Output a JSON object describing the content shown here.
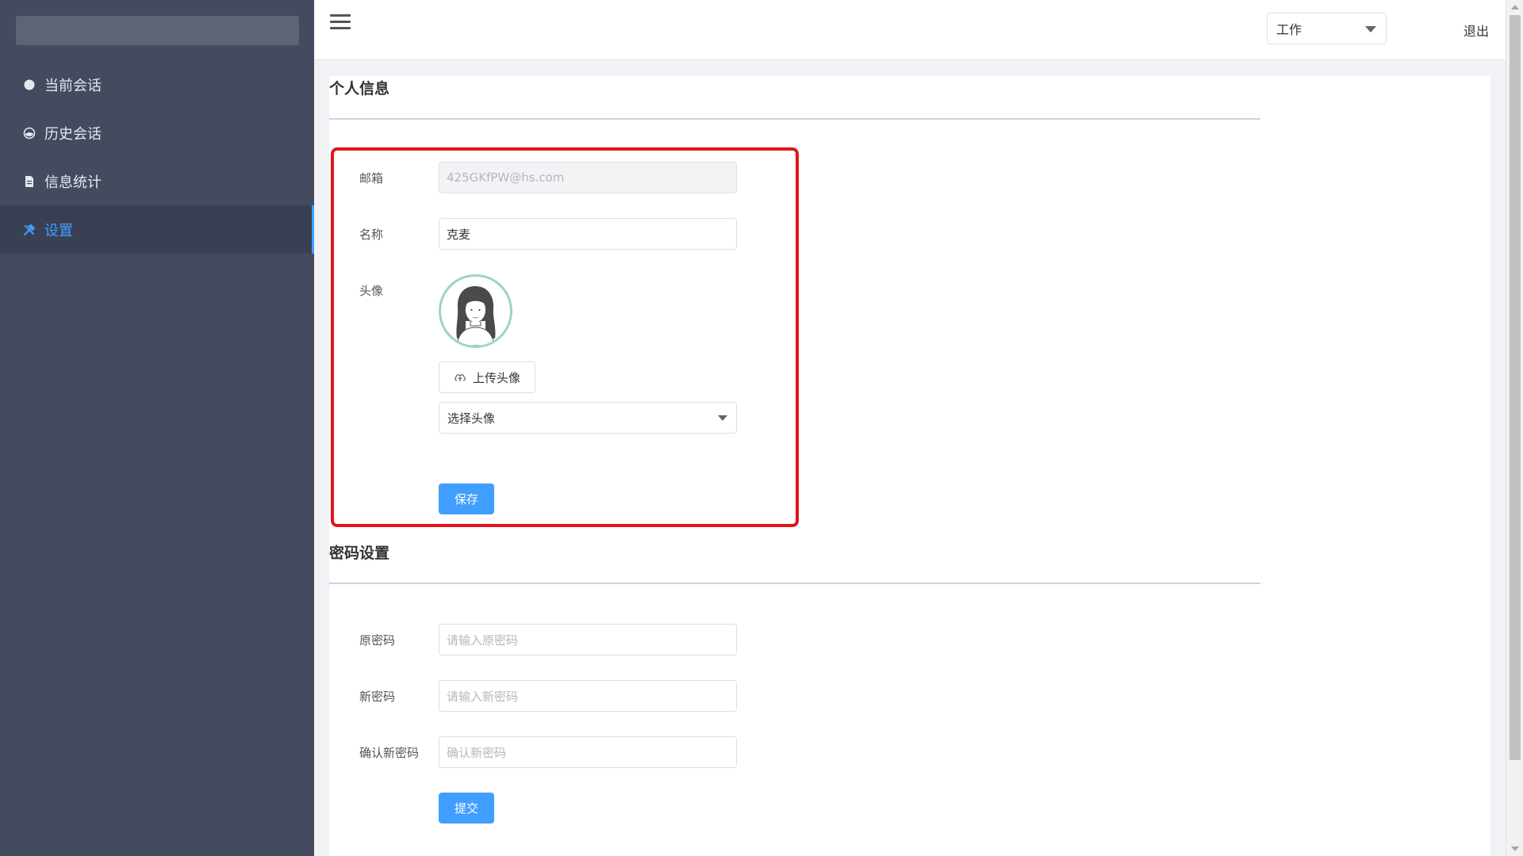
{
  "sidebar": {
    "items": [
      {
        "label": "当前会话",
        "icon": "chat-bubble-icon",
        "active": false
      },
      {
        "label": "历史会话",
        "icon": "history-icon",
        "active": false
      },
      {
        "label": "信息统计",
        "icon": "document-icon",
        "active": false
      },
      {
        "label": "设置",
        "icon": "tools-icon",
        "active": true
      }
    ]
  },
  "header": {
    "role_select_value": "工作",
    "logout_label": "退出"
  },
  "profile": {
    "title": "个人信息",
    "email_label": "邮箱",
    "email_value": "425GKfPW@hs.com",
    "name_label": "名称",
    "name_value": "克麦",
    "avatar_label": "头像",
    "upload_label": "上传头像",
    "avatar_select_value": "选择头像",
    "save_label": "保存"
  },
  "password": {
    "title": "密码设置",
    "old_label": "原密码",
    "old_placeholder": "请输入原密码",
    "new_label": "新密码",
    "new_placeholder": "请输入新密码",
    "confirm_label": "确认新密码",
    "confirm_placeholder": "确认新密码",
    "submit_label": "提交"
  },
  "colors": {
    "sidebar_bg": "#444b5e",
    "accent": "#409eff",
    "highlight": "#e3141c"
  }
}
